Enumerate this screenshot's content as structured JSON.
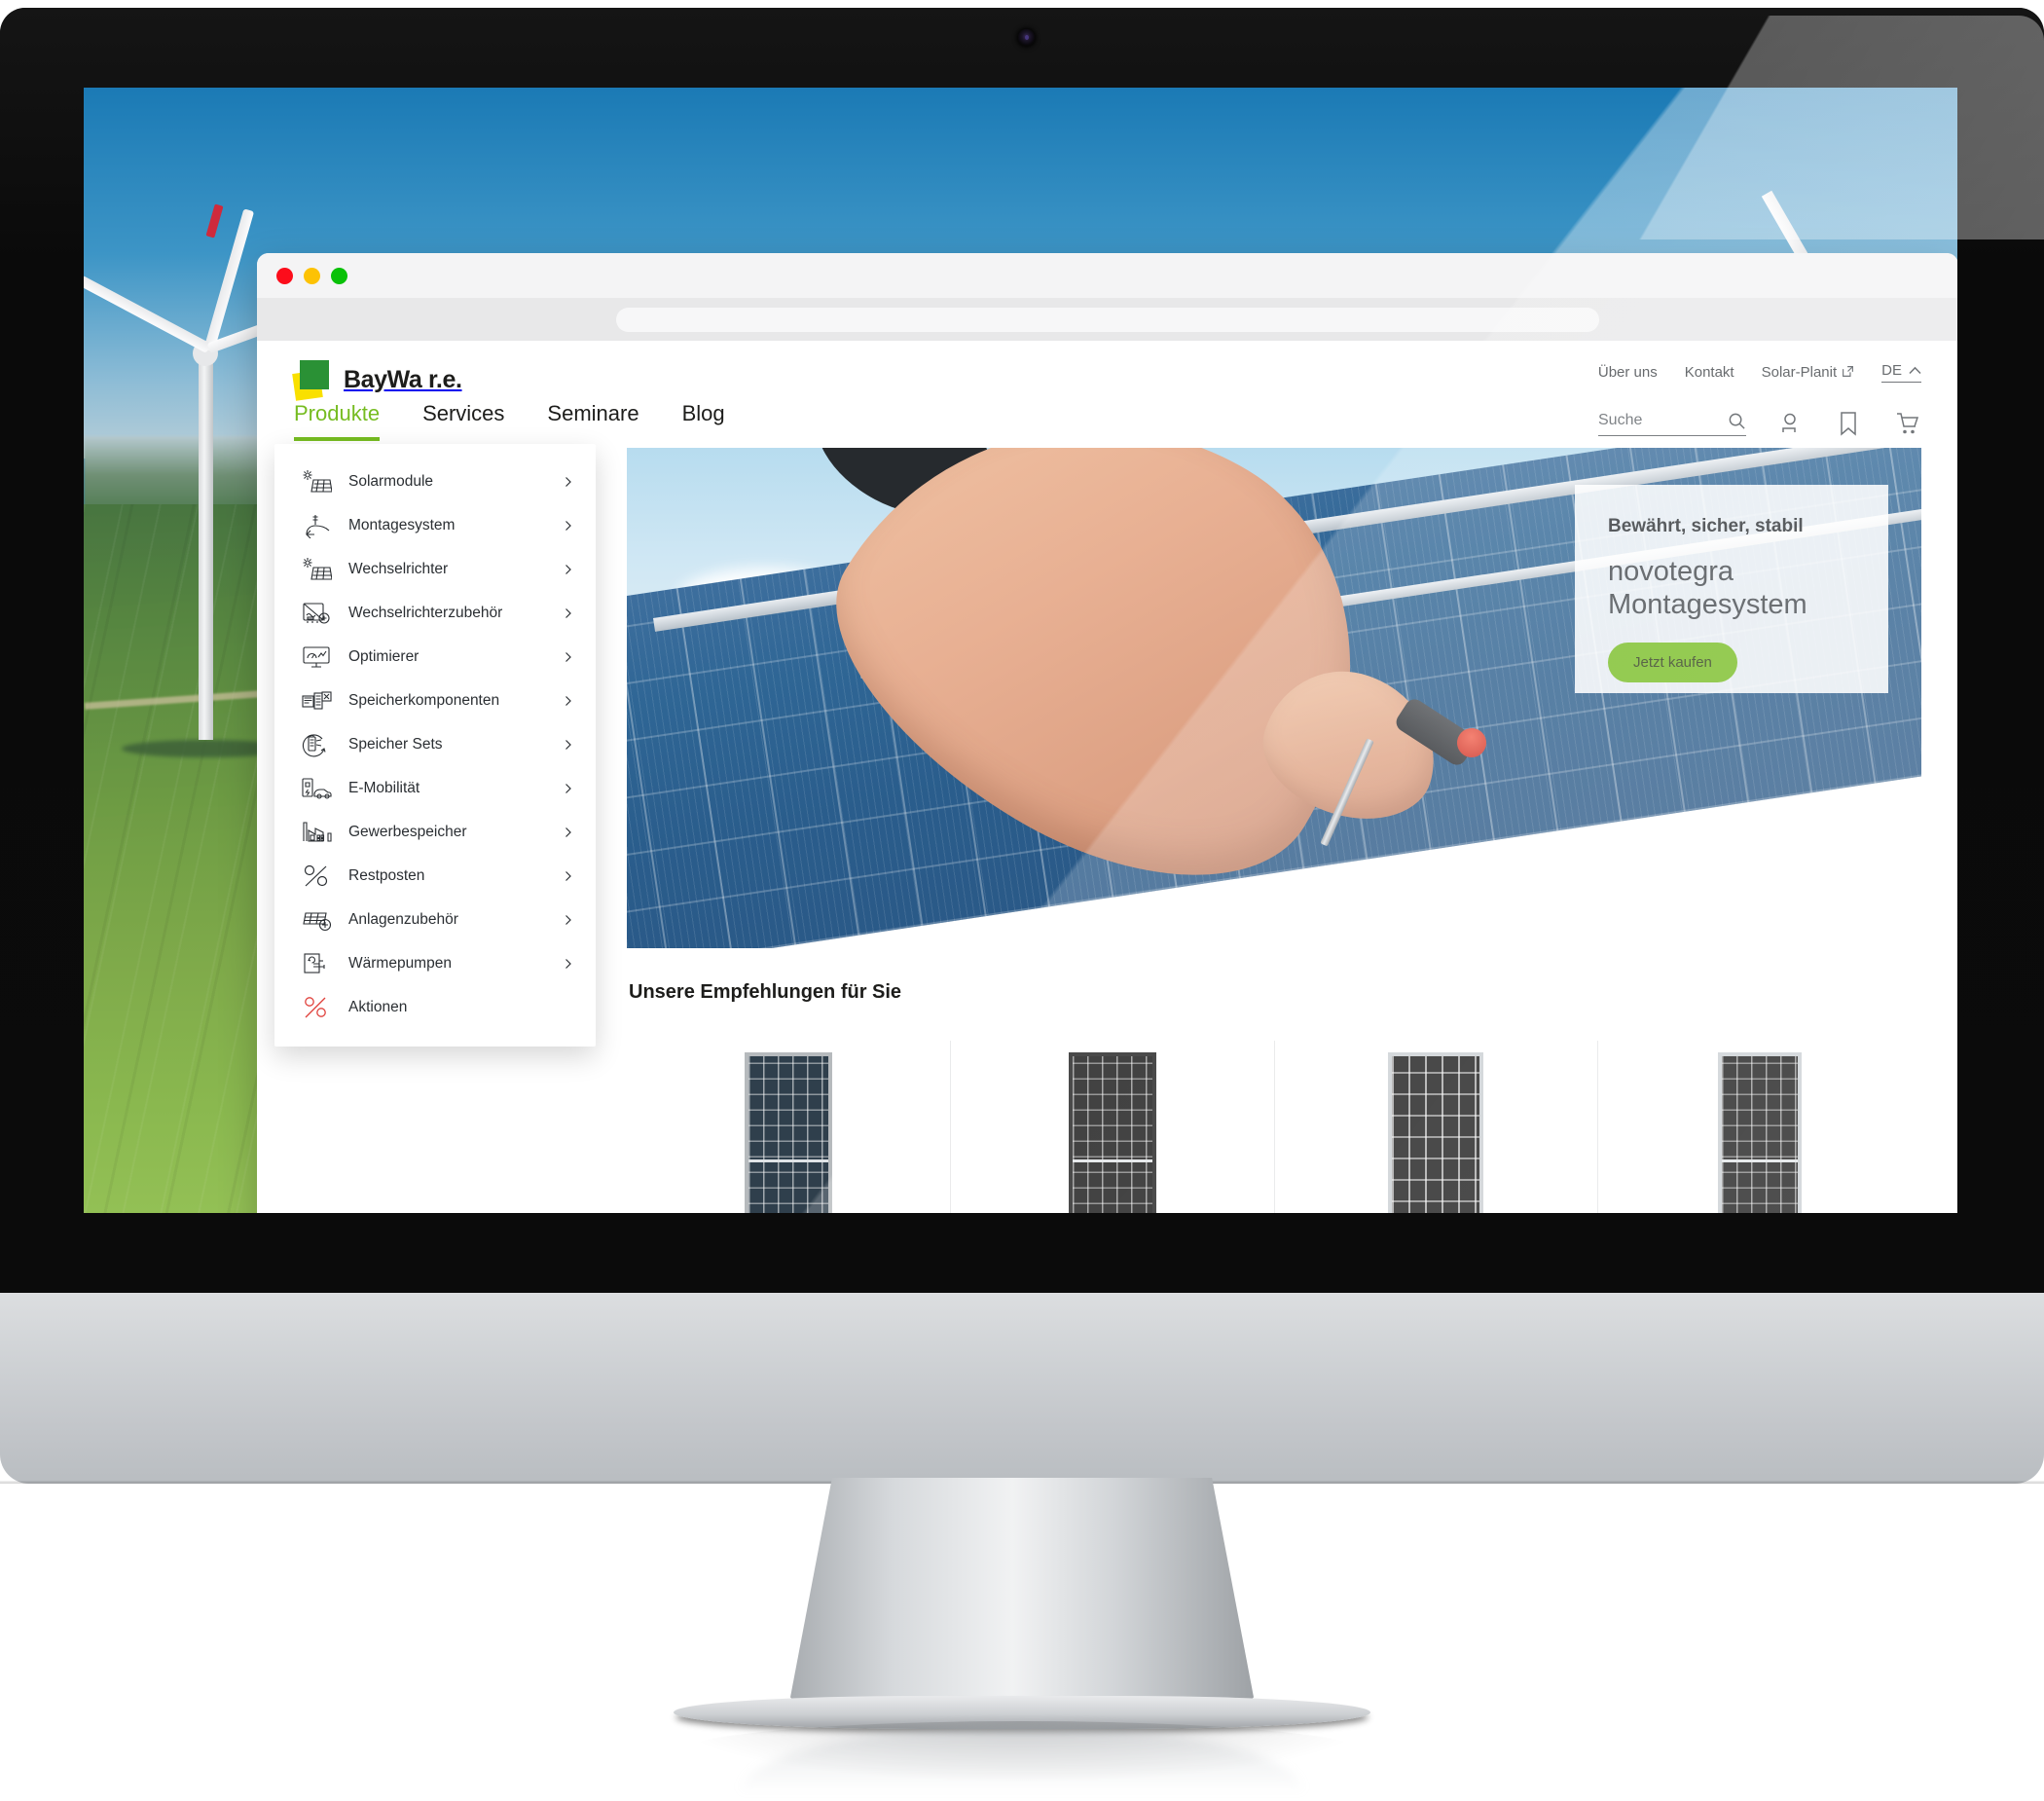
{
  "browser": {
    "traffic_lights": [
      "close",
      "minimize",
      "zoom"
    ],
    "url_value": ""
  },
  "site": {
    "brand": {
      "name": "BayWa r.e.",
      "logo_green": "#2a9135",
      "logo_yellow": "#f9e000"
    },
    "accent_green": "#76bc21",
    "utility_nav": [
      {
        "label": "Über uns",
        "external": false
      },
      {
        "label": "Kontakt",
        "external": false
      },
      {
        "label": "Solar-Planit",
        "external": true
      }
    ],
    "language": {
      "code": "DE",
      "chevron": "chevron-up-icon"
    },
    "main_nav": [
      {
        "label": "Produkte",
        "active": true
      },
      {
        "label": "Services",
        "active": false
      },
      {
        "label": "Seminare",
        "active": false
      },
      {
        "label": "Blog",
        "active": false
      }
    ],
    "search": {
      "placeholder": "Suche",
      "value": "",
      "icon": "search-icon"
    },
    "header_icons": [
      {
        "name": "account-icon"
      },
      {
        "name": "bookmark-icon"
      },
      {
        "name": "cart-icon"
      }
    ],
    "mega_menu": {
      "items": [
        {
          "label": "Solarmodule",
          "icon": "solar-panel-sun-icon",
          "has_chevron": true
        },
        {
          "label": "Montagesystem",
          "icon": "mounting-rail-icon",
          "has_chevron": true
        },
        {
          "label": "Wechselrichter",
          "icon": "solar-panel-sun-icon",
          "has_chevron": true
        },
        {
          "label": "Wechselrichterzubehör",
          "icon": "inverter-plus-icon",
          "has_chevron": true
        },
        {
          "label": "Optimierer",
          "icon": "monitor-chart-icon",
          "has_chevron": true
        },
        {
          "label": "Speicherkomponenten",
          "icon": "battery-rack-icon",
          "has_chevron": true
        },
        {
          "label": "Speicher Sets",
          "icon": "battery-circle-icon",
          "has_chevron": true
        },
        {
          "label": "E-Mobilität",
          "icon": "ev-charger-car-icon",
          "has_chevron": true
        },
        {
          "label": "Gewerbespeicher",
          "icon": "factory-battery-icon",
          "has_chevron": true
        },
        {
          "label": "Restposten",
          "icon": "percent-icon",
          "has_chevron": true
        },
        {
          "label": "Anlagenzubehör",
          "icon": "panel-plus-icon",
          "has_chevron": true
        },
        {
          "label": "Wärmepumpen",
          "icon": "heat-pump-icon",
          "has_chevron": true
        },
        {
          "label": "Aktionen",
          "icon": "percent-red-icon",
          "has_chevron": false
        }
      ]
    },
    "hero": {
      "image_alt": "Hand mit Schraubendreher montiert Solarmodul",
      "promo": {
        "kicker": "Bewährt, sicher, stabil",
        "title": "novotegra Montagesystem",
        "cta_label": "Jetzt kaufen"
      }
    },
    "recommendations": {
      "title": "Unsere Empfehlungen für Sie",
      "cards": [
        {
          "image_alt": "Solarmodul Silberrahmen blau",
          "style": "silver-blue"
        },
        {
          "image_alt": "Solarmodul Full-Black",
          "style": "full-black"
        },
        {
          "image_alt": "Solarmodul Silberrahmen schwarz",
          "style": "silver-black"
        },
        {
          "image_alt": "Solarmodul Silberrahmen halbzellen",
          "style": "silver-half"
        }
      ]
    }
  },
  "desktop": {
    "wallpaper_alt": "Luftaufnahme Windräder über grünen Feldern"
  }
}
